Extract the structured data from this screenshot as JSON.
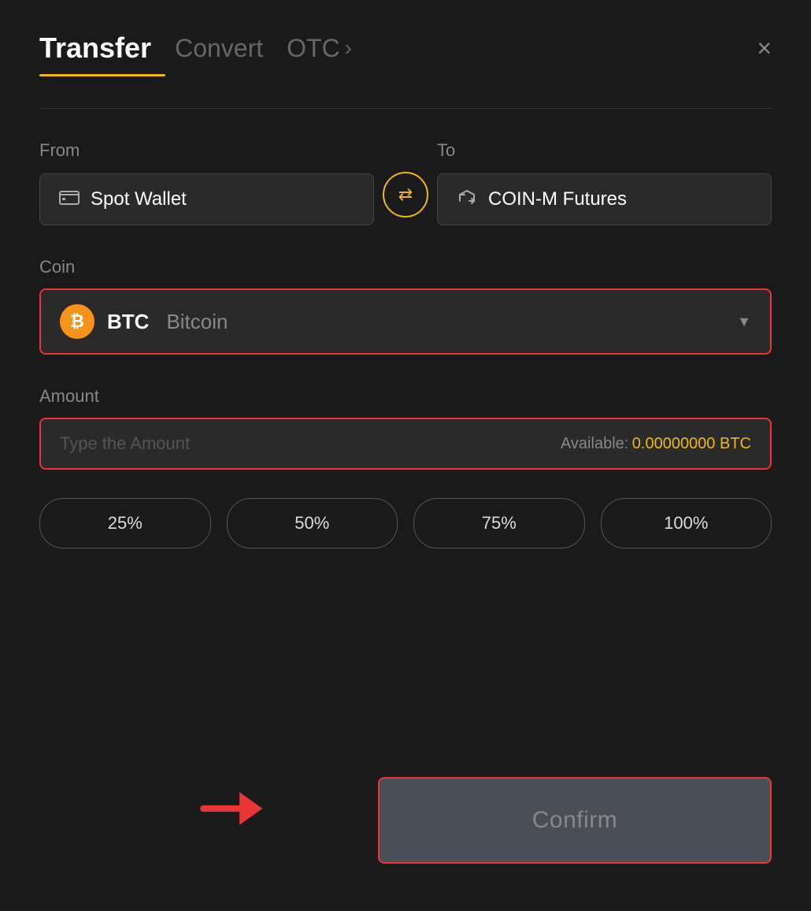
{
  "header": {
    "tab_transfer": "Transfer",
    "tab_convert": "Convert",
    "tab_otc": "OTC",
    "close_label": "×"
  },
  "from_section": {
    "label": "From",
    "wallet_label": "Spot Wallet"
  },
  "to_section": {
    "label": "To",
    "wallet_label": "COIN-M Futures"
  },
  "coin_section": {
    "label": "Coin",
    "symbol": "BTC",
    "full_name": "Bitcoin"
  },
  "amount_section": {
    "label": "Amount",
    "placeholder": "Type the Amount",
    "available_label": "Available:",
    "available_value": "0.00000000 BTC"
  },
  "pct_buttons": [
    "25%",
    "50%",
    "75%",
    "100%"
  ],
  "confirm_button": {
    "label": "Confirm"
  }
}
